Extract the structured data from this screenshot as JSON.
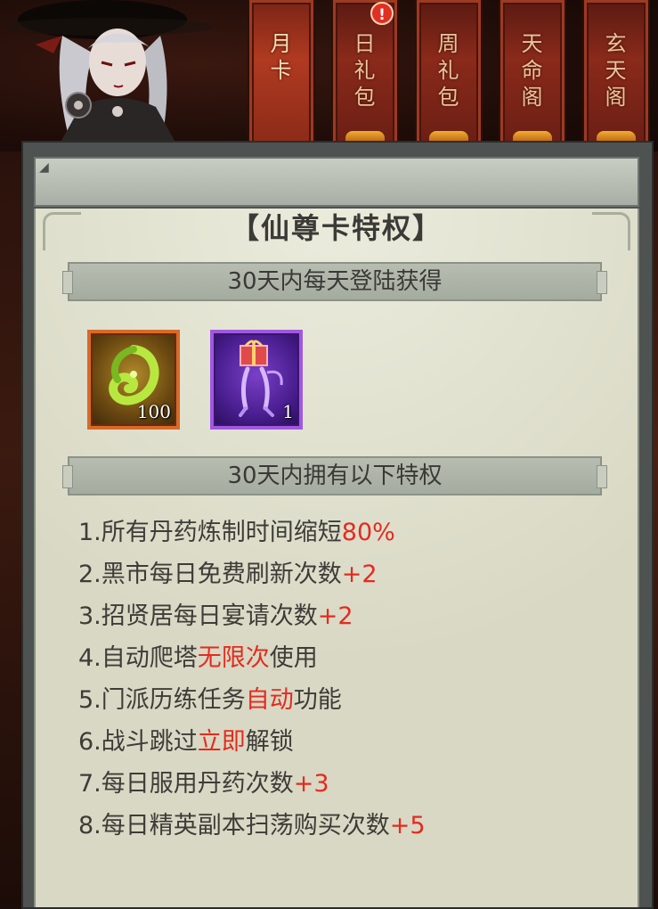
{
  "tabs": [
    {
      "label": "月卡",
      "active": true,
      "badge": false
    },
    {
      "label": "日礼包",
      "active": false,
      "badge": true
    },
    {
      "label": "周礼包",
      "active": false,
      "badge": false
    },
    {
      "label": "天命阁",
      "active": false,
      "badge": false
    },
    {
      "label": "玄天阁",
      "active": false,
      "badge": false
    }
  ],
  "badge_text": "!",
  "panel": {
    "title": "【仙尊卡特权】",
    "section1": "30天内每天登陆获得",
    "section2": "30天内拥有以下特权"
  },
  "rewards": [
    {
      "name": "jade-pendant",
      "count": "100",
      "frame": "orange"
    },
    {
      "name": "gift-mount",
      "count": "1",
      "frame": "purple"
    }
  ],
  "privileges": [
    {
      "num": "1.",
      "pre": "所有丹药炼制时间缩短",
      "hl": "80%",
      "post": ""
    },
    {
      "num": "2.",
      "pre": "黑市每日免费刷新次数",
      "hl": "+2",
      "post": ""
    },
    {
      "num": "3.",
      "pre": "招贤居每日宴请次数",
      "hl": "+2",
      "post": ""
    },
    {
      "num": "4.",
      "pre": "自动爬塔",
      "hl": "无限次",
      "post": "使用"
    },
    {
      "num": "5.",
      "pre": "门派历练任务",
      "hl": "自动",
      "post": "功能"
    },
    {
      "num": "6.",
      "pre": "战斗跳过",
      "hl": "立即",
      "post": "解锁"
    },
    {
      "num": "7.",
      "pre": "每日服用丹药次数",
      "hl": "+3",
      "post": ""
    },
    {
      "num": "8.",
      "pre": "每日精英副本扫荡购买次数",
      "hl": "+5",
      "post": ""
    }
  ],
  "colors": {
    "highlight": "#e52a1e",
    "text": "#3e3c38",
    "tab": "#8a2a1a"
  }
}
